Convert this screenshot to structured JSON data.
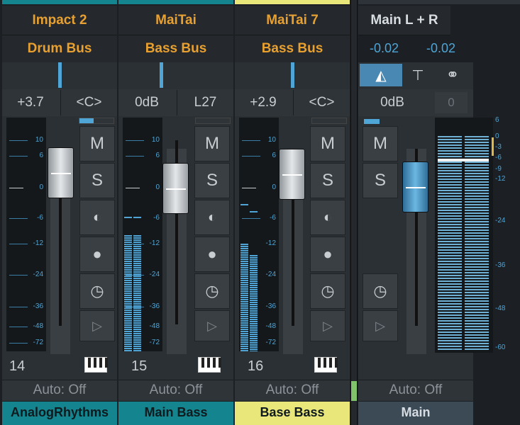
{
  "colors": {
    "channel_name": "#e8a030",
    "level_blue": "#4ea5d6",
    "teal_label": "#14858f",
    "yellow_label": "#eae77a",
    "master_label": "#3c4a55"
  },
  "channels": [
    {
      "name": "Impact 2",
      "bus": "Drum Bus",
      "volume": "+3.7",
      "pan": "<C>",
      "number": "14",
      "mute": "M",
      "solo": "S",
      "automation": "Auto: Off",
      "label": "AnalogRhythms",
      "label_color": "#14858f",
      "top_color": "#14858f"
    },
    {
      "name": "MaiTai",
      "bus": "Bass Bus",
      "volume": "0dB",
      "pan": "L27",
      "number": "15",
      "mute": "M",
      "solo": "S",
      "automation": "Auto: Off",
      "label": "Main Bass",
      "label_color": "#14858f",
      "top_color": "#14858f"
    },
    {
      "name": "MaiTai 7",
      "bus": "Bass Bus",
      "volume": "+2.9",
      "pan": "<C>",
      "number": "16",
      "mute": "M",
      "solo": "S",
      "automation": "Auto: Off",
      "label": "Base Bass",
      "label_color": "#eae77a",
      "top_color": "#eae77a"
    }
  ],
  "master": {
    "name": "Main L + R",
    "level_left": "-0.02",
    "level_right": "-0.02",
    "volume": "0dB",
    "peak": "0",
    "mute": "M",
    "solo": "S",
    "automation": "Auto: Off",
    "label": "Main"
  },
  "channel_scale": [
    "10",
    "6",
    "0",
    "-6",
    "-12",
    "-24",
    "-36",
    "-48",
    "-72"
  ],
  "master_scale": [
    "6",
    "0",
    "-3",
    "-6",
    "-9",
    "-12",
    "-24",
    "-36",
    "-48",
    "-60"
  ],
  "icons": {
    "monitor": "headphone-monitor-icon",
    "record": "record-arm-icon",
    "input": "input-knob-icon",
    "play": "play-icon",
    "keyboard": "keyboard-icon"
  }
}
